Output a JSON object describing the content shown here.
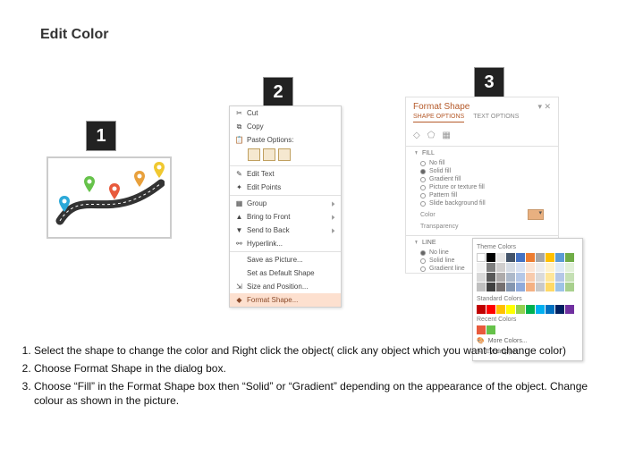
{
  "title": "Edit Color",
  "steps": {
    "n1": "1",
    "n2": "2",
    "n3": "3"
  },
  "contextMenu": {
    "cut": "Cut",
    "copy": "Copy",
    "pasteOptions": "Paste Options:",
    "editText": "Edit Text",
    "editPoints": "Edit Points",
    "group": "Group",
    "bringToFront": "Bring to Front",
    "sendToBack": "Send to Back",
    "hyperlink": "Hyperlink...",
    "saveAsPicture": "Save as Picture...",
    "setDefault": "Set as Default Shape",
    "sizePosition": "Size and Position...",
    "formatShape": "Format Shape..."
  },
  "formatPane": {
    "title": "Format Shape",
    "tabShape": "SHAPE OPTIONS",
    "tabText": "TEXT OPTIONS",
    "secFill": "FILL",
    "noFill": "No fill",
    "solidFill": "Solid fill",
    "gradientFill": "Gradient fill",
    "pictureFill": "Picture or texture fill",
    "patternFill": "Pattern fill",
    "slideBgFill": "Slide background fill",
    "colorLabel": "Color",
    "transparency": "Transparency",
    "secLine": "LINE",
    "noLine": "No line",
    "solidLine": "Solid line",
    "gradientLine": "Gradient line"
  },
  "colorPop": {
    "theme": "Theme Colors",
    "standard": "Standard Colors",
    "recent": "Recent Colors",
    "more": "More Colors...",
    "eyedropper": "Eyedropper"
  },
  "instructions": {
    "i1": "Select the shape to change the color and Right click the object( click any object which you want to change color)",
    "i2": "Choose Format Shape in the dialog box.",
    "i3": "Choose “Fill” in the Format Shape box then “Solid” or “Gradient” depending on the appearance of the object. Change colour as shown in the picture."
  }
}
